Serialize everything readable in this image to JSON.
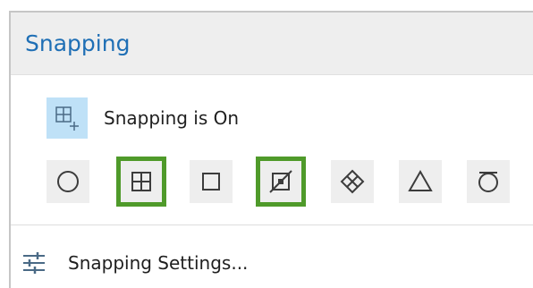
{
  "panel": {
    "title": "Snapping",
    "colors": {
      "title": "#1f6fb5",
      "active_border": "#4f9a2a",
      "status_icon_bg": "#bfe1f7"
    }
  },
  "status": {
    "label": "Snapping is On",
    "icon": "snapping-toggle-icon"
  },
  "tools": [
    {
      "icon": "point-snap-icon",
      "active": false
    },
    {
      "icon": "grid-snap-icon",
      "active": true
    },
    {
      "icon": "edge-snap-icon",
      "active": false
    },
    {
      "icon": "vertex-snap-icon",
      "active": true
    },
    {
      "icon": "intersection-snap-icon",
      "active": false
    },
    {
      "icon": "midpoint-snap-icon",
      "active": false
    },
    {
      "icon": "tangent-snap-icon",
      "active": false
    }
  ],
  "settings": {
    "label": "Snapping Settings...",
    "icon": "settings-sliders-icon"
  }
}
